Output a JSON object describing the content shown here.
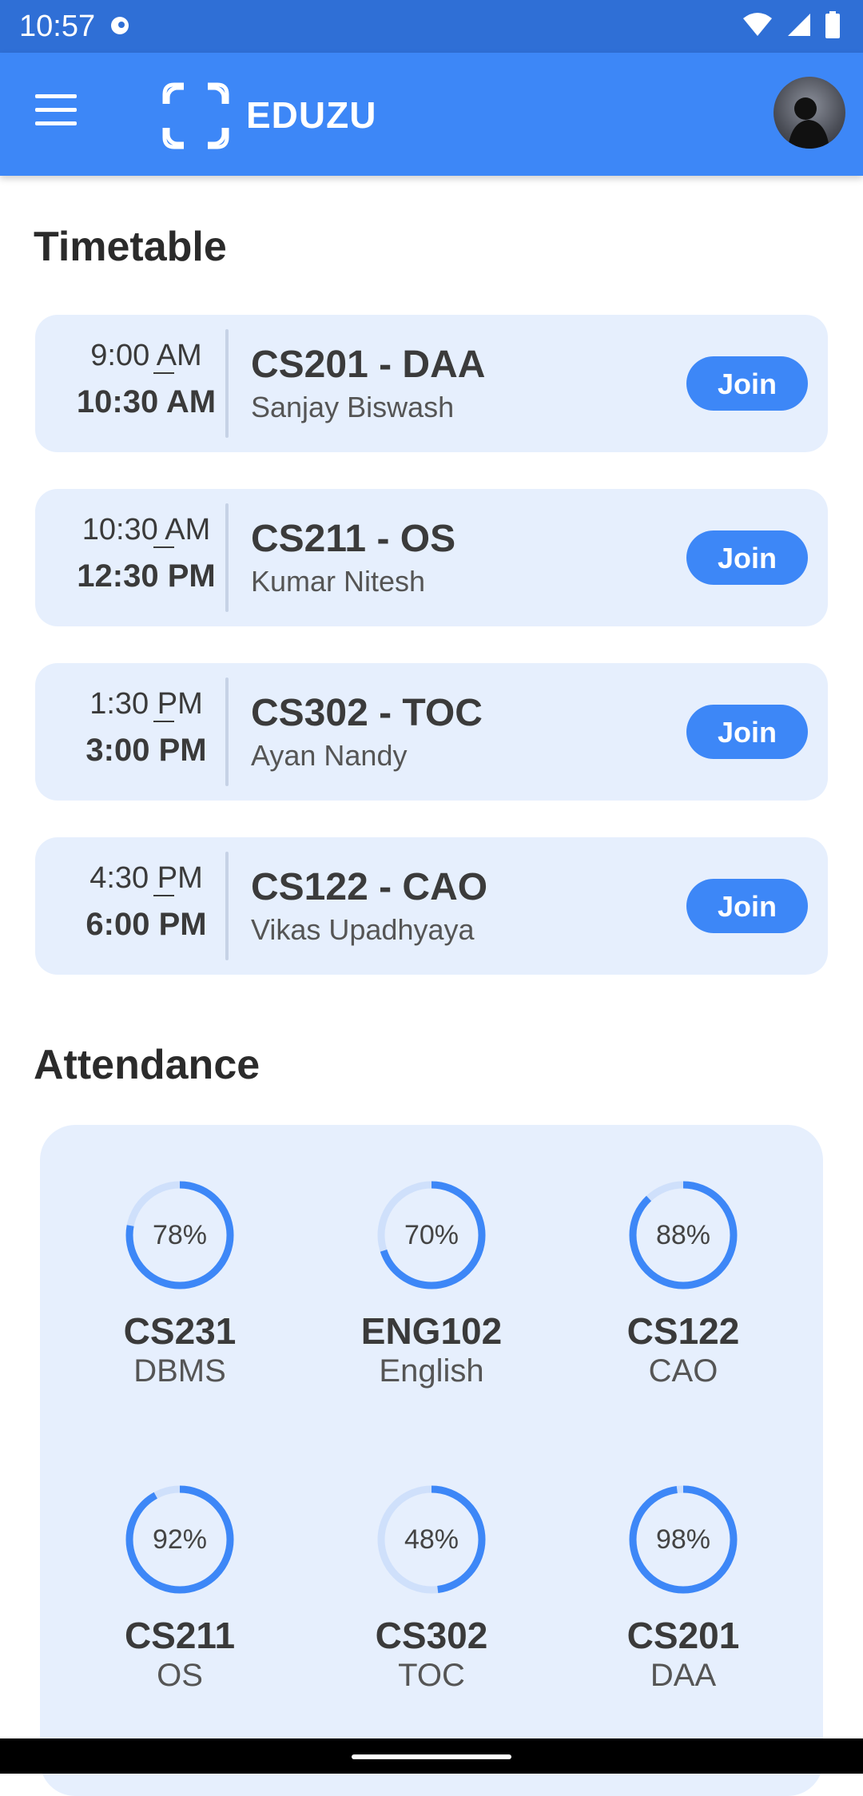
{
  "status_bar": {
    "time": "10:57"
  },
  "app_bar": {
    "brand": "EDUZU",
    "accent_color": "#3d87f7"
  },
  "timetable": {
    "title": "Timetable",
    "items": [
      {
        "start": "9:00 AM",
        "end": "10:30 AM",
        "course": "CS201 - DAA",
        "teacher": "Sanjay Biswash",
        "action": "Join"
      },
      {
        "start": "10:30 AM",
        "end": "12:30 PM",
        "course": "CS211 - OS",
        "teacher": "Kumar Nitesh",
        "action": "Join"
      },
      {
        "start": "1:30 PM",
        "end": "3:00 PM",
        "course": "CS302 - TOC",
        "teacher": "Ayan Nandy",
        "action": "Join"
      },
      {
        "start": "4:30 PM",
        "end": "6:00 PM",
        "course": "CS122 - CAO",
        "teacher": "Vikas Upadhyaya",
        "action": "Join"
      }
    ]
  },
  "attendance": {
    "title": "Attendance",
    "items": [
      {
        "percent_label": "78%",
        "percent": 78,
        "code": "CS231",
        "name": "DBMS"
      },
      {
        "percent_label": "70%",
        "percent": 70,
        "code": "ENG102",
        "name": "English"
      },
      {
        "percent_label": "88%",
        "percent": 88,
        "code": "CS122",
        "name": "CAO"
      },
      {
        "percent_label": "92%",
        "percent": 92,
        "code": "CS211",
        "name": "OS"
      },
      {
        "percent_label": "48%",
        "percent": 48,
        "code": "CS302",
        "name": "TOC"
      },
      {
        "percent_label": "98%",
        "percent": 98,
        "code": "CS201",
        "name": "DAA"
      }
    ]
  }
}
